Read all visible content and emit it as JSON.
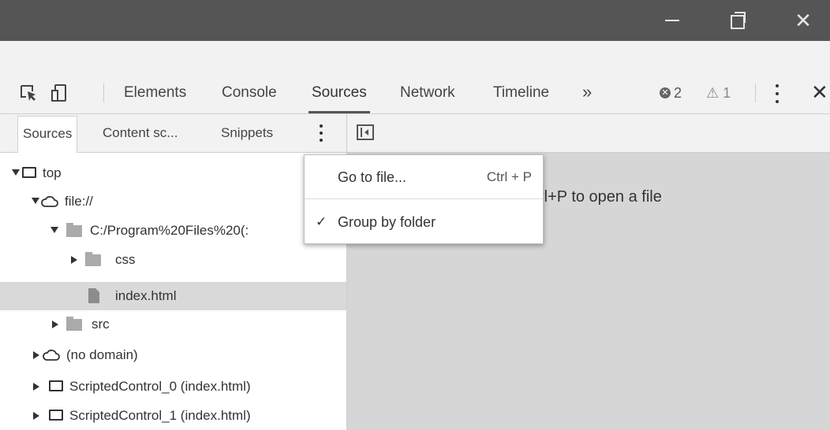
{
  "devtools": {
    "tabs": [
      "Elements",
      "Console",
      "Sources",
      "Network",
      "Timeline"
    ],
    "active_tab": "Sources",
    "more_tabs": "»",
    "error_count": "2",
    "warning_count": "1",
    "close": "✕"
  },
  "window_controls": {
    "close": "✕"
  },
  "sources": {
    "subtabs": [
      "Sources",
      "Content sc...",
      "Snippets"
    ],
    "placeholder_text": "rl+P to open a file"
  },
  "navigator": {
    "rows": [
      {
        "label": "top",
        "icon": "frame-icon",
        "expand": "down"
      },
      {
        "label": "file://",
        "icon": "cloud-icon",
        "expand": "down"
      },
      {
        "label": "C:/Program%20Files%20(:",
        "icon": "folder-icon",
        "expand": "down"
      },
      {
        "label": "css",
        "icon": "folder-icon",
        "expand": "right"
      },
      {
        "label": "index.html",
        "icon": "file-icon",
        "expand": "none",
        "selected": true
      },
      {
        "label": "src",
        "icon": "folder-icon",
        "expand": "right"
      },
      {
        "label": "(no domain)",
        "icon": "cloud-icon",
        "expand": "right"
      },
      {
        "label": "ScriptedControl_0 (index.html)",
        "icon": "frame-icon",
        "expand": "right"
      },
      {
        "label": "ScriptedControl_1 (index.html)",
        "icon": "frame-icon",
        "expand": "right"
      }
    ]
  },
  "menu": {
    "items": [
      {
        "label": "Go to file...",
        "shortcut": "Ctrl + P"
      },
      {
        "label": "Group by folder",
        "checked": "✓"
      }
    ]
  }
}
